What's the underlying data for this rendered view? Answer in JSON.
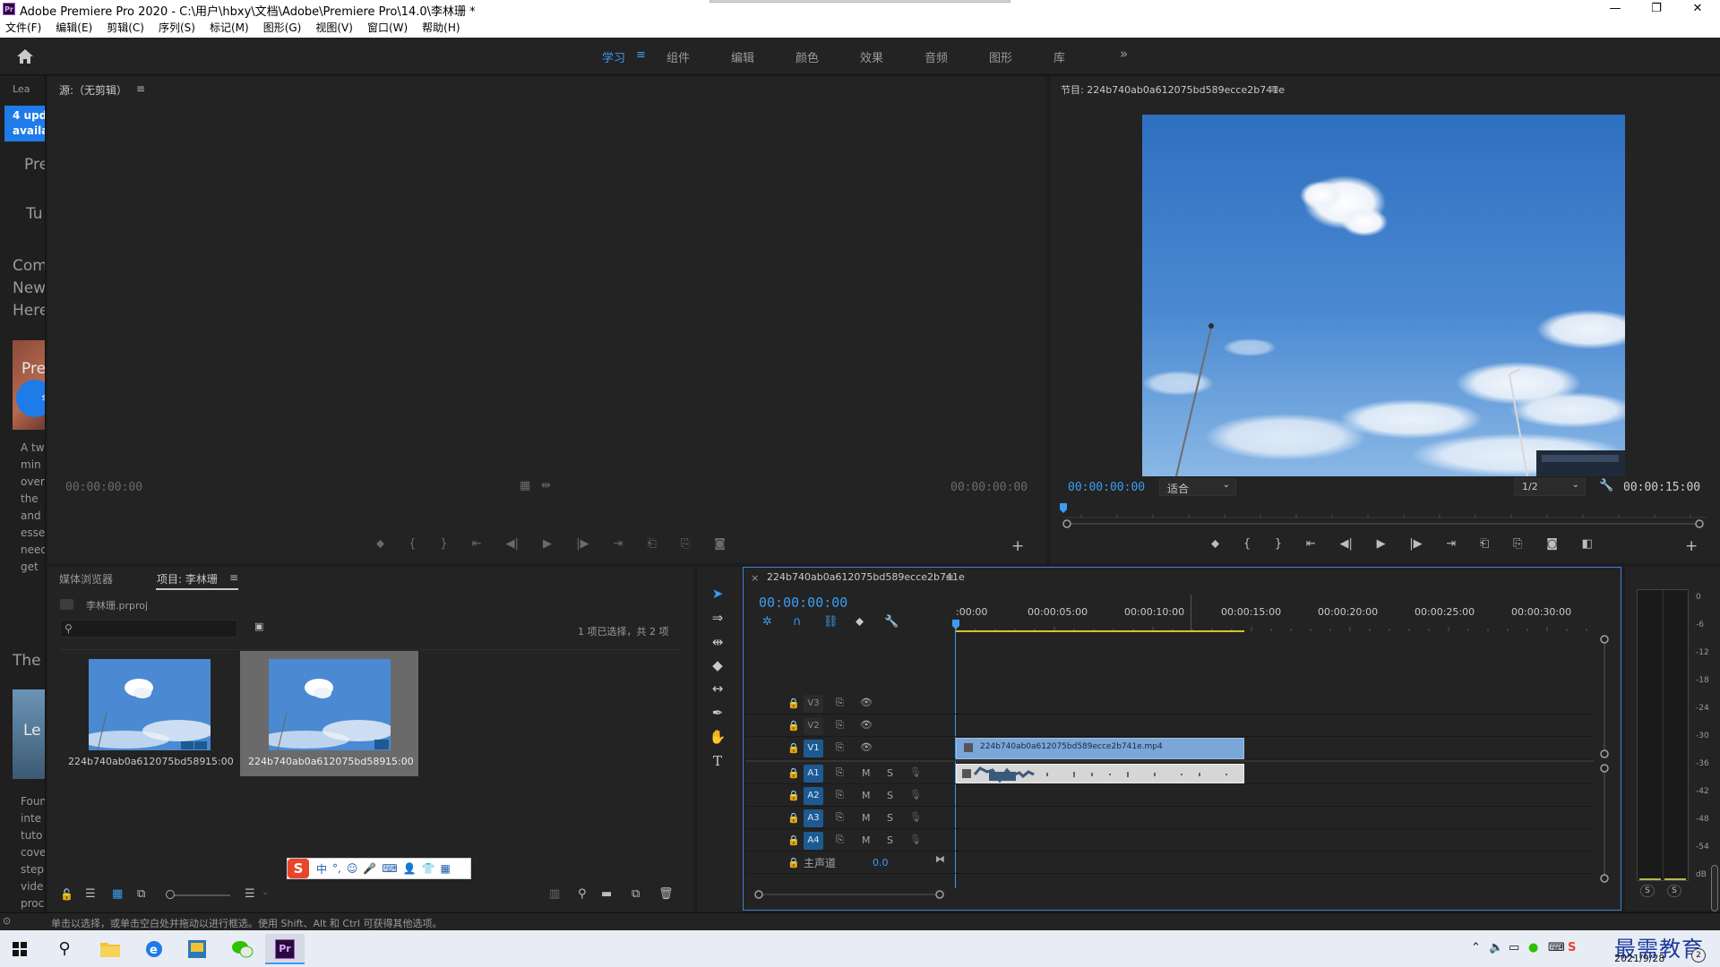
{
  "window": {
    "app_badge": "Pr",
    "title": "Adobe Premiere Pro 2020 - C:\\用户\\hbxy\\文档\\Adobe\\Premiere Pro\\14.0\\李林珊 *",
    "minimize": "—",
    "restore": "❐",
    "close": "✕"
  },
  "menu": [
    "文件(F)",
    "编辑(E)",
    "剪辑(C)",
    "序列(S)",
    "标记(M)",
    "图形(G)",
    "视图(V)",
    "窗口(W)",
    "帮助(H)"
  ],
  "workspaces": {
    "items": [
      "学习",
      "组件",
      "编辑",
      "颜色",
      "效果",
      "音频",
      "图形",
      "库"
    ],
    "active": "学习",
    "more": "»"
  },
  "learn": {
    "title": "Lea",
    "update_line1": "4 upd",
    "update_line2": "availa",
    "lines": [
      "Pre",
      "Tu",
      "Com",
      "New",
      "Here"
    ],
    "card_title": "Pre",
    "para1": [
      "A tw",
      "min",
      "over",
      "the",
      "and",
      "esse",
      "need",
      "get"
    ],
    "the": "The",
    "card2_title": "Le",
    "para2": [
      "Foun",
      "inte",
      "tuto",
      "cove",
      "step",
      "vide",
      "proc"
    ],
    "badge": "s"
  },
  "source": {
    "title": "源:（无剪辑）",
    "menu": "≡",
    "tc_left": "00:00:00:00",
    "tc_right": "00:00:00:00"
  },
  "program": {
    "title": "节目: 224b740ab0a612075bd589ecce2b741e",
    "menu": "≡",
    "tc_current": "00:00:00:00",
    "fit": "适合",
    "quality": "1/2",
    "tc_duration": "00:00:15:00"
  },
  "project": {
    "tab_media": "媒体浏览器",
    "tab_project": "项目: 李林珊",
    "menu": "≡",
    "file": "李林珊.prproj",
    "selection": "1 项已选择，共 2 项",
    "items": [
      {
        "name": "224b740ab0a612075bd589...",
        "duration": "15:00"
      },
      {
        "name": "224b740ab0a612075bd589...",
        "duration": "15:00"
      }
    ]
  },
  "ime": {
    "logo": "S",
    "items": [
      "中",
      "°,",
      "☺",
      "🎤",
      "⌨",
      "👤",
      "👕",
      "▦"
    ]
  },
  "timeline": {
    "close": "×",
    "sequence": "224b740ab0a612075bd589ecce2b741e",
    "menu": "≡",
    "tc": "00:00:00:00",
    "ruler": [
      ":00:00",
      "00:00:05:00",
      "00:00:10:00",
      "00:00:15:00",
      "00:00:20:00",
      "00:00:25:00",
      "00:00:30:00"
    ],
    "video_tracks": [
      "V3",
      "V2",
      "V1"
    ],
    "audio_tracks": [
      "A1",
      "A2",
      "A3",
      "A4"
    ],
    "mute": "M",
    "solo": "S",
    "master_label": "主声道",
    "master_value": "0.0",
    "clip_name": "224b740ab0a612075bd589ecce2b741e.mp4"
  },
  "meters": {
    "scale": [
      "0",
      "-6",
      "-12",
      "-18",
      "-24",
      "-30",
      "-36",
      "-42",
      "-48",
      "-54",
      "dB"
    ],
    "solo": [
      "S",
      "S"
    ]
  },
  "status": {
    "text": "单击以选择，或单击空白处并拖动以进行框选。使用 Shift、Alt 和 Ctrl 可获得其他选项。"
  },
  "taskbar": {
    "start": "⊞",
    "search": "⚲",
    "pr": "Pr",
    "date": "2021/9/28",
    "watermark": "最需教育",
    "notify": "2"
  },
  "colors": {
    "accent": "#3b9cf2",
    "panel": "#232323",
    "bg": "#1d1d1d",
    "clip_video": "#7aa6d9",
    "clip_audio": "#d6d6d6",
    "work_area": "#d9c12a"
  }
}
